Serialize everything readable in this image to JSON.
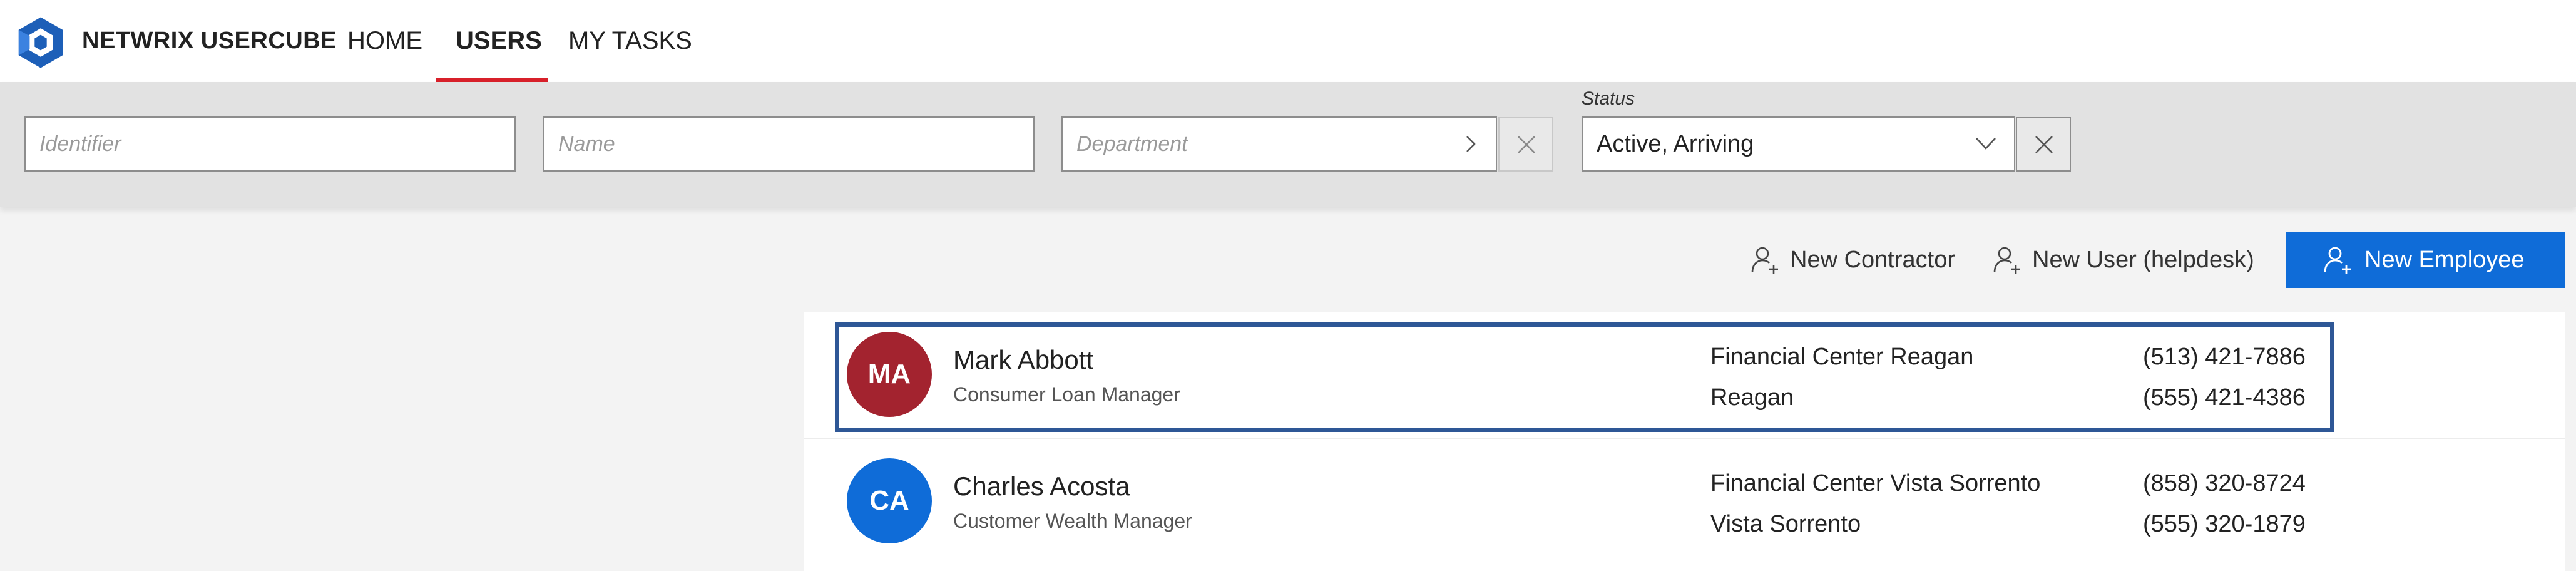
{
  "app": {
    "brand": "NETWRIX USERCUBE"
  },
  "nav": {
    "home": "HOME",
    "users": "USERS",
    "my_tasks": "MY TASKS",
    "active": "USERS"
  },
  "filters": {
    "identifier_placeholder": "Identifier",
    "name_placeholder": "Name",
    "department_placeholder": "Department",
    "status_label": "Status",
    "status_value": "Active, Arriving"
  },
  "actions": {
    "new_contractor": "New Contractor",
    "new_user_helpdesk": "New User (helpdesk)",
    "new_employee": "New Employee"
  },
  "users": [
    {
      "initials": "MA",
      "name": "Mark Abbott",
      "title": "Consumer Loan Manager",
      "location_line1": "Financial Center Reagan",
      "location_line2": "Reagan",
      "phone1": "(513) 421-7886",
      "phone2": "(555) 421-4386",
      "avatar_color": "#a3232f",
      "selected": true
    },
    {
      "initials": "CA",
      "name": "Charles Acosta",
      "title": "Customer Wealth Manager",
      "location_line1": "Financial Center Vista Sorrento",
      "location_line2": "Vista Sorrento",
      "phone1": "(858) 320-8724",
      "phone2": "(555) 320-1879",
      "avatar_color": "#0f6cd8",
      "selected": false
    }
  ],
  "colors": {
    "accent": "#0f6cd8",
    "nav_underline": "#d8202a",
    "selection_border": "#2e5796"
  },
  "icons": {
    "logo": "netwrix-hex-logo-icon",
    "chevron_right": "chevron-right-icon",
    "chevron_down": "chevron-down-icon",
    "clear": "close-icon",
    "add_person": "add-person-icon"
  }
}
